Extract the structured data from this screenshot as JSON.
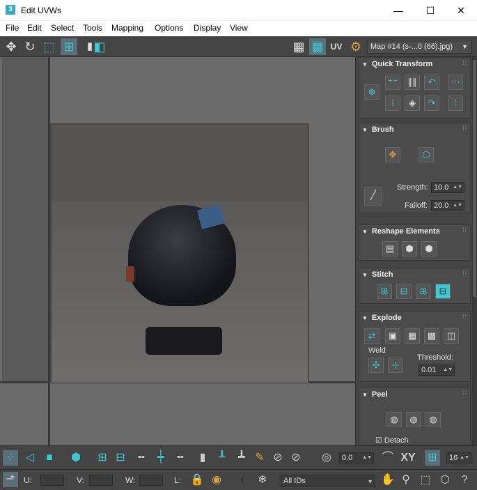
{
  "window": {
    "title": "Edit UVWs",
    "app_icon": "3"
  },
  "window_controls": {
    "minimize": "—",
    "maximize": "☐",
    "close": "✕"
  },
  "menu": [
    "File",
    "Edit",
    "Select",
    "Tools",
    "Mapping",
    "Options",
    "Display",
    "View"
  ],
  "toolbar": {
    "uv_label": "UV",
    "map_selector": "Map #14 (s-...0 (66).jpg)"
  },
  "panel": {
    "quick_transform": {
      "title": "Quick Transform"
    },
    "brush": {
      "title": "Brush",
      "strength_label": "Strength:",
      "strength_value": "10.0",
      "falloff_label": "Falloff:",
      "falloff_value": "20.0"
    },
    "reshape": {
      "title": "Reshape Elements"
    },
    "stitch": {
      "title": "Stitch"
    },
    "explode": {
      "title": "Explode",
      "weld_label": "Weld",
      "threshold_label": "Threshold:",
      "threshold_value": "0.01"
    },
    "peel": {
      "title": "Peel",
      "detach_label": "Detach"
    }
  },
  "bottom_toolbar": {
    "rotate_value": "0.0",
    "xy_label": "XY",
    "grid_value": "16"
  },
  "status": {
    "u_label": "U:",
    "v_label": "V:",
    "w_label": "W:",
    "l_label": "L:",
    "ids_dropdown": "All IDs"
  }
}
